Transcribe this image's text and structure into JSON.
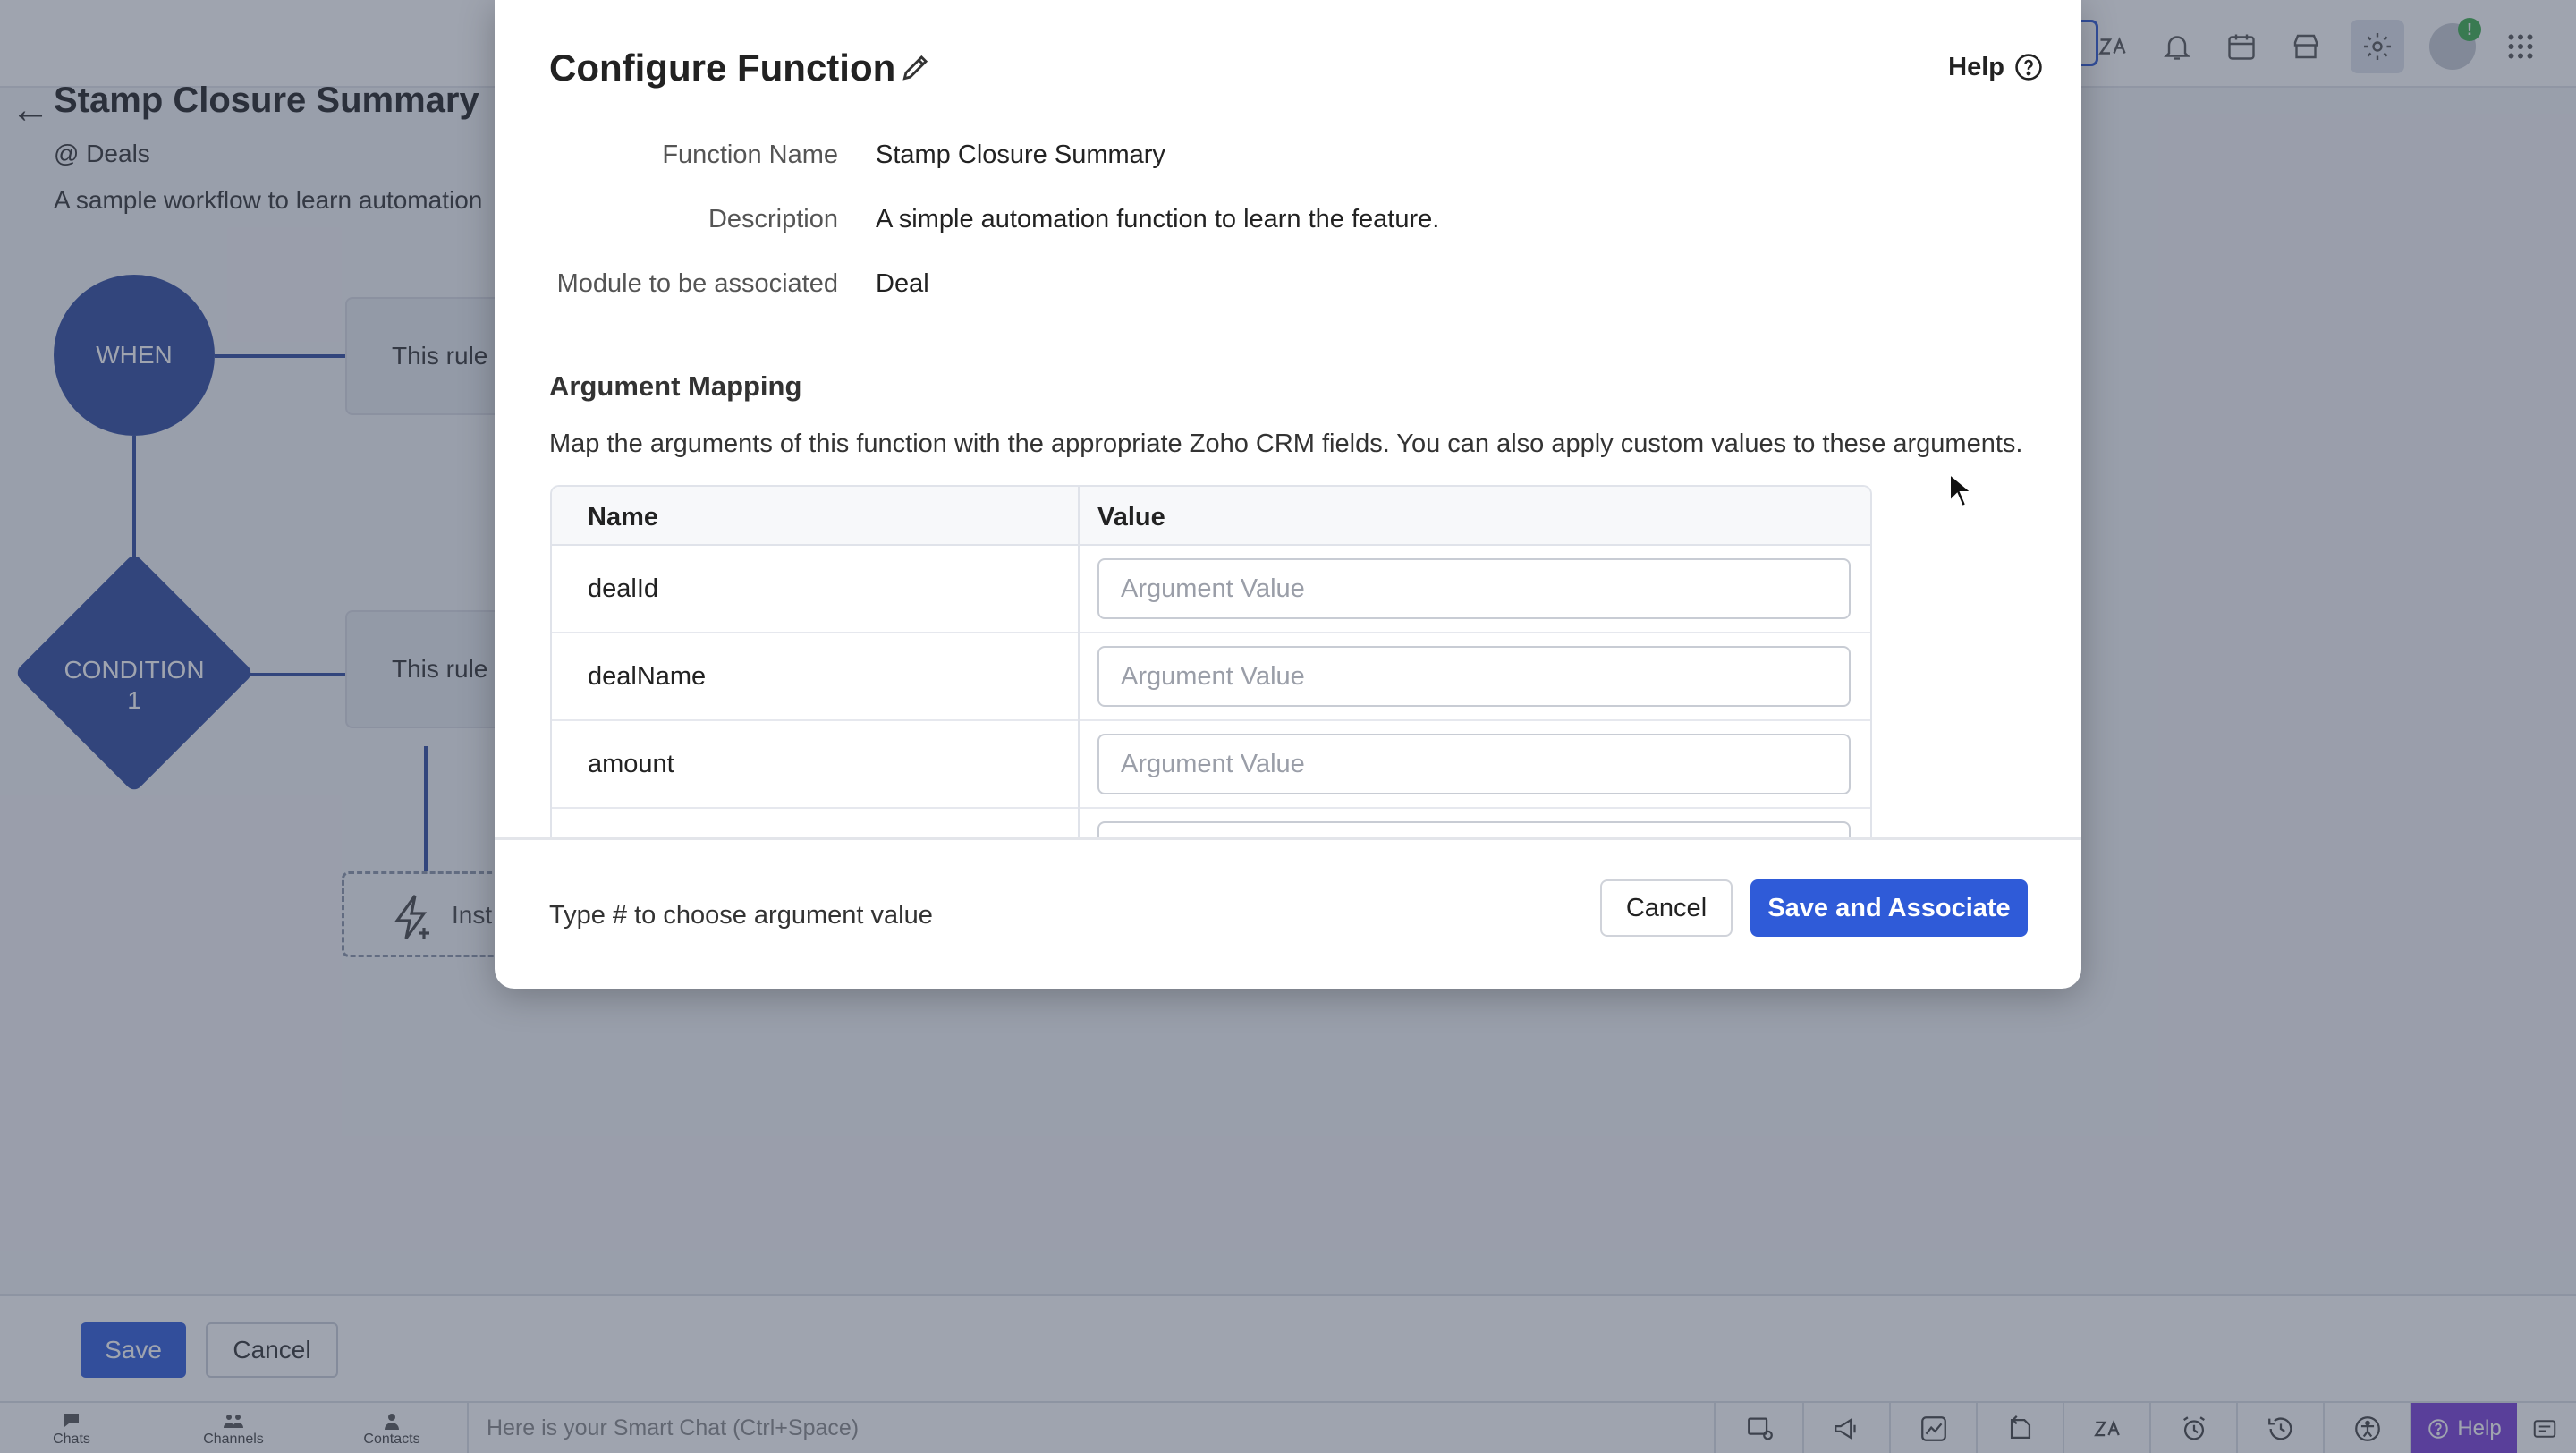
{
  "background": {
    "workflow_title": "Stamp Closure Summary",
    "workflow_module": "@ Deals",
    "workflow_description": "A sample workflow to learn automation",
    "when_node": "WHEN",
    "condition_node": "CONDITION\n1",
    "condition_line1": "CONDITION",
    "condition_line2": "1",
    "rule_box_1": "This rule",
    "rule_box_2": "This rule",
    "instant_box": "Inst",
    "save_label": "Save",
    "cancel_label": "Cancel"
  },
  "modal": {
    "title": "Configure Function",
    "help_label": "Help",
    "fields": [
      {
        "label": "Function Name",
        "value": "Stamp Closure Summary"
      },
      {
        "label": "Description",
        "value": "A simple automation function to learn the feature."
      },
      {
        "label": "Module to be associated",
        "value": "Deal"
      }
    ],
    "section_title": "Argument Mapping",
    "section_description": "Map the arguments of this function with the appropriate Zoho CRM fields. You can also apply custom values to these arguments.",
    "table": {
      "headers": [
        "Name",
        "Value"
      ],
      "rows": [
        {
          "name": "dealId",
          "value": "",
          "placeholder": "Argument Value"
        },
        {
          "name": "dealName",
          "value": "",
          "placeholder": "Argument Value"
        },
        {
          "name": "amount",
          "value": "",
          "placeholder": "Argument Value"
        }
      ]
    },
    "footer_hint": "Type # to choose argument value",
    "cancel_label": "Cancel",
    "save_label": "Save and Associate"
  },
  "bottom_bar": {
    "nav": [
      "Chats",
      "Channels",
      "Contacts"
    ],
    "smart_chat_placeholder": "Here is your Smart Chat (Ctrl+Space)",
    "help_label": "Help"
  },
  "top_bar": {
    "notification_badge": "!"
  },
  "colors": {
    "accent": "#2f5bd8",
    "workflow_node": "#2e4a9e",
    "help_button": "#7a3fd6"
  }
}
